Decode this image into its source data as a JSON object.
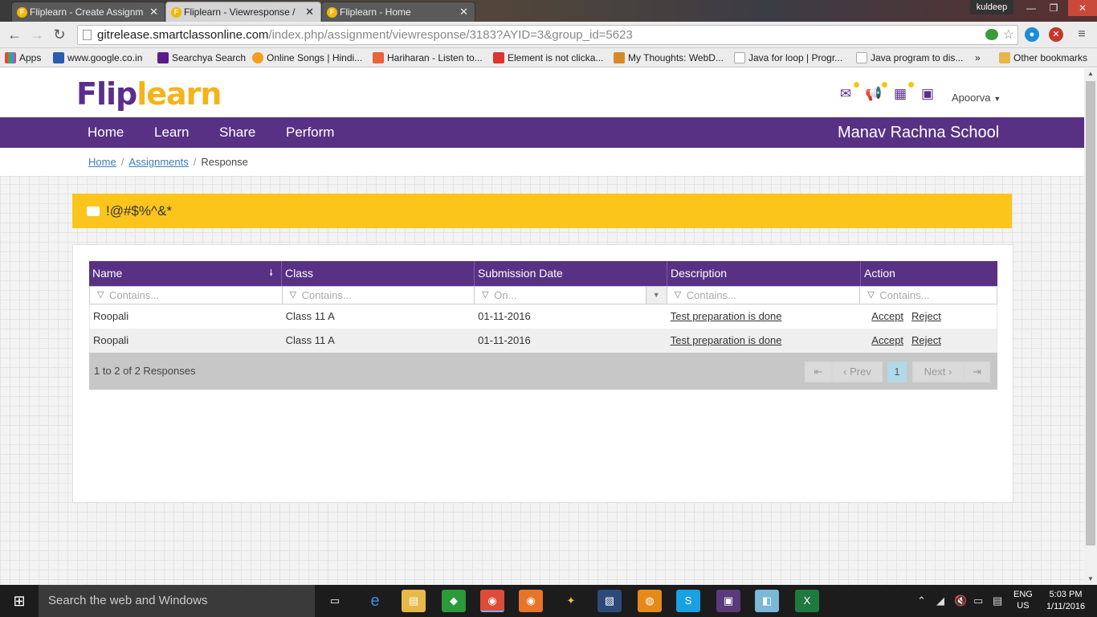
{
  "browser": {
    "tabs": [
      {
        "title": "Fliplearn - Create Assignm",
        "active": false
      },
      {
        "title": "Fliplearn - Viewresponse /",
        "active": true
      },
      {
        "title": "Fliplearn - Home",
        "active": false
      }
    ],
    "user": "kuldeep",
    "url_host": "gitrelease.smartclassonline.com",
    "url_path": "/index.php/assignment/viewresponse/3183?AYID=3&group_id=5623",
    "bookmarks": [
      "Apps",
      "www.google.co.in",
      "Searchya Search",
      "Online Songs | Hindi...",
      "Hariharan - Listen to...",
      "Element is not clicka...",
      "My Thoughts: WebD...",
      "Java for loop | Progr...",
      "Java program to dis...",
      "»",
      "Other bookmarks"
    ]
  },
  "site": {
    "logo_part1": "Flip",
    "logo_part2": "learn",
    "user_name": "Apoorva",
    "nav": [
      "Home",
      "Learn",
      "Share",
      "Perform"
    ],
    "school": "Manav Rachna School"
  },
  "breadcrumb": {
    "home": "Home",
    "assignments": "Assignments",
    "current": "Response",
    "separator": "/"
  },
  "assignment_title": "!@#$%^&*",
  "grid": {
    "columns": [
      "Name",
      "Class",
      "Submission Date",
      "Description",
      "Action"
    ],
    "filters": [
      "Contains...",
      "Contains...",
      "On...",
      "Contains...",
      "Contains..."
    ],
    "rows": [
      {
        "name": "Roopali",
        "class": "Class 11 A",
        "date": "01-11-2016",
        "description": "Test preparation is done",
        "accept": "Accept",
        "reject": "Reject"
      },
      {
        "name": "Roopali",
        "class": "Class 11 A",
        "date": "01-11-2016",
        "description": "Test preparation is done",
        "accept": "Accept",
        "reject": "Reject"
      }
    ],
    "summary": "1 to 2 of 2 Responses",
    "pager": {
      "first": "⇤",
      "prev": "‹ Prev",
      "current": "1",
      "next": "Next ›",
      "last": "⇥"
    }
  },
  "taskbar": {
    "search_placeholder": "Search the web and Windows",
    "lang": "ENG",
    "region": "US",
    "time": "5:03 PM",
    "date": "1/11/2016"
  },
  "colors": {
    "brand_purple": "#583185",
    "brand_yellow": "#fbc51c",
    "pager_current": "#b1d9e8"
  }
}
